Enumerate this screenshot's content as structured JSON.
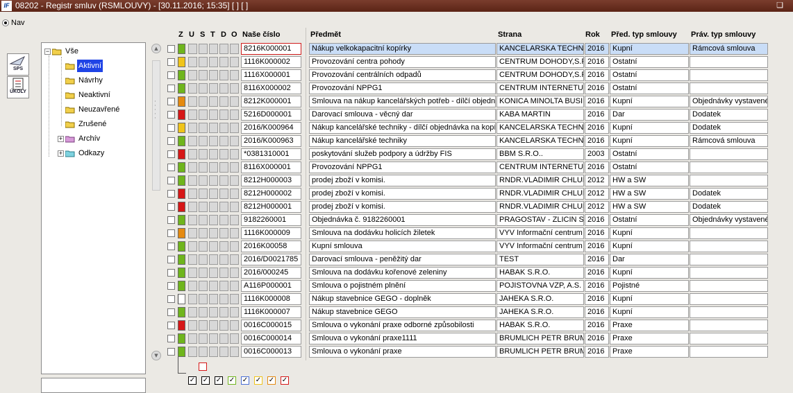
{
  "window": {
    "title": "08202 - Registr smluv (RSMLOUVY) - [30.11.2016; 15:35]  [ ]  [ ]",
    "app_icon": "IF"
  },
  "nav": {
    "label": "Nav"
  },
  "side_icons": [
    {
      "name": "sps-icon",
      "label": "SPS"
    },
    {
      "name": "ukoly-icon",
      "label": "ÚKOLY"
    }
  ],
  "tree": {
    "root": "Vše",
    "items": [
      {
        "label": "Aktivní",
        "selected": true
      },
      {
        "label": "Návrhy"
      },
      {
        "label": "Neaktivní"
      },
      {
        "label": "Neuzavřené"
      },
      {
        "label": "Zrušené"
      }
    ],
    "groups": [
      {
        "label": "Archív"
      },
      {
        "label": "Odkazy"
      }
    ]
  },
  "columns": {
    "flags": [
      "Z",
      "U",
      "S",
      "T",
      "D",
      "O"
    ],
    "nase_cislo": "Naše číslo",
    "predmet": "Předmět",
    "strana": "Strana",
    "rok": "Rok",
    "pred_typ": "Před. typ smlouvy",
    "prav_typ": "Práv. typ smlouvy"
  },
  "colors": {
    "green": "#6fb51c",
    "orange": "#e58a10",
    "yellow": "#f0c419",
    "red": "#d61717",
    "selected_row": "#c9ddf7"
  },
  "rows": [
    {
      "color": "green",
      "num": "8216K000001",
      "predmet": "Nákup velkokapacitní kopírky",
      "strana": "KANCELARSKA TECHNIKA",
      "rok": "2016",
      "pred": "Kupní",
      "prav": "Rámcová smlouva",
      "selected": true
    },
    {
      "color": "yellow",
      "num": "1116K000002",
      "predmet": "Provozování centra pohody",
      "strana": "CENTRUM DOHODY,S.R.O.",
      "rok": "2016",
      "pred": "Ostatní",
      "prav": ""
    },
    {
      "color": "green",
      "num": "1116X000001",
      "predmet": "Provozování centrálních odpadů",
      "strana": "CENTRUM DOHODY,S.R.O.",
      "rok": "2016",
      "pred": "Ostatní",
      "prav": ""
    },
    {
      "color": "green",
      "num": "8116X000002",
      "predmet": "Provozování NPPG1",
      "strana": "CENTRUM INTERNETU ( IČ",
      "rok": "2016",
      "pred": "Ostatní",
      "prav": ""
    },
    {
      "color": "orange",
      "num": "8212K000001",
      "predmet": "Smlouva na nákup kancelářských potřeb - dílčí  objednávka",
      "strana": "KONICA MINOLTA BUSINESS",
      "rok": "2016",
      "pred": "Kupní",
      "prav": "Objednávky vystavené"
    },
    {
      "color": "red",
      "num": "5216D000001",
      "predmet": "Darovací smlouva - věcný dar",
      "strana": "KABA MARTIN",
      "rok": "2016",
      "pred": "Dar",
      "prav": "Dodatek"
    },
    {
      "color": "yellow",
      "num": "2016/K000964",
      "predmet": "Nákup kancelářské techniky - dílčí objednávka na kopírku",
      "strana": "KANCELARSKA TECHNIKA",
      "rok": "2016",
      "pred": "Kupní",
      "prav": "Dodatek"
    },
    {
      "color": "green",
      "num": "2016/K000963",
      "predmet": "Nákup kancelářské techniky",
      "strana": "KANCELARSKA TECHNIKA",
      "rok": "2016",
      "pred": "Kupní",
      "prav": "Rámcová smlouva"
    },
    {
      "color": "red",
      "num": "*0381310001",
      "predmet": "poskytování služeb podpory a údržby FIS",
      "strana": "BBM S.R.O..",
      "rok": "2003",
      "pred": "Ostatní",
      "prav": ""
    },
    {
      "color": "green",
      "num": "8116X000001",
      "predmet": "Provozování NPPG1",
      "strana": "CENTRUM INTERNETU ( IČ",
      "rok": "2016",
      "pred": "Ostatní",
      "prav": ""
    },
    {
      "color": "green",
      "num": "8212H000003",
      "predmet": "prodej zboží v komisi.",
      "strana": "RNDR.VLADIMIR CHLUP",
      "rok": "2012",
      "pred": "HW a SW",
      "prav": ""
    },
    {
      "color": "red",
      "num": "8212H000002",
      "predmet": "prodej zboží v komisi.",
      "strana": "RNDR.VLADIMIR CHLUP",
      "rok": "2012",
      "pred": "HW a SW",
      "prav": "Dodatek"
    },
    {
      "color": "red",
      "num": "8212H000001",
      "predmet": "prodej zboží v komisi.",
      "strana": "RNDR.VLADIMIR CHLUP",
      "rok": "2012",
      "pred": "HW a SW",
      "prav": "Dodatek"
    },
    {
      "color": "green",
      "num": "9182260001",
      "predmet": "Objednávka č. 9182260001",
      "strana": "PRAGOSTAV - ZLICIN S",
      "rok": "2016",
      "pred": "Ostatní",
      "prav": "Objednávky vystavené"
    },
    {
      "color": "orange",
      "num": "1116K000009",
      "predmet": "Smlouva na dodávku holicích žiletek",
      "strana": "VYV Informační centrum",
      "rok": "2016",
      "pred": "Kupní",
      "prav": ""
    },
    {
      "color": "green",
      "num": "2016K00058",
      "predmet": "Kupní smlouva",
      "strana": "VYV Informační centrum",
      "rok": "2016",
      "pred": "Kupní",
      "prav": ""
    },
    {
      "color": "green",
      "num": "2016/D0021785",
      "predmet": "Darovací smlouva - peněžitý dar",
      "strana": "TEST",
      "rok": "2016",
      "pred": "Dar",
      "prav": ""
    },
    {
      "color": "green",
      "num": "2016/000245",
      "predmet": "Smlouva na dodávku kořenové zeleniny",
      "strana": "HABAK S.R.O.",
      "rok": "2016",
      "pred": "Kupní",
      "prav": ""
    },
    {
      "color": "green",
      "num": "A116P000001",
      "predmet": "Smlouva o pojistném plnění",
      "strana": "POJISTOVNA VZP, A.S.",
      "rok": "2016",
      "pred": "Pojistné",
      "prav": ""
    },
    {
      "color": "none",
      "num": "1116K000008",
      "predmet": "Nákup stavebnice GEGO - doplněk",
      "strana": "JAHEKA S.R.O.",
      "rok": "2016",
      "pred": "Kupní",
      "prav": ""
    },
    {
      "color": "green",
      "num": "1116K000007",
      "predmet": "Nákup stavebnice GEGO",
      "strana": "JAHEKA S.R.O.",
      "rok": "2016",
      "pred": "Kupní",
      "prav": ""
    },
    {
      "color": "red",
      "num": "0016C000015",
      "predmet": "Smlouva o vykonání praxe odborné způsobilosti",
      "strana": "HABAK S.R.O.",
      "rok": "2016",
      "pred": "Praxe",
      "prav": ""
    },
    {
      "color": "green",
      "num": "0016C000014",
      "predmet": "Smlouva o vykonání praxe1111",
      "strana": " BRUMLICH PETR BRUM - ",
      "rok": "2016",
      "pred": "Praxe",
      "prav": ""
    },
    {
      "color": "green",
      "num": "0016C000013",
      "predmet": "Smlouva o vykonání praxe",
      "strana": " BRUMLICH PETR BRUM - ",
      "rok": "2016",
      "pred": "Praxe",
      "prav": ""
    }
  ],
  "legend_colors": [
    "#000000",
    "#000000",
    "#000000",
    "#6fb51c",
    "#4a6fd6",
    "#f0c419",
    "#e58a10",
    "#d61717"
  ]
}
